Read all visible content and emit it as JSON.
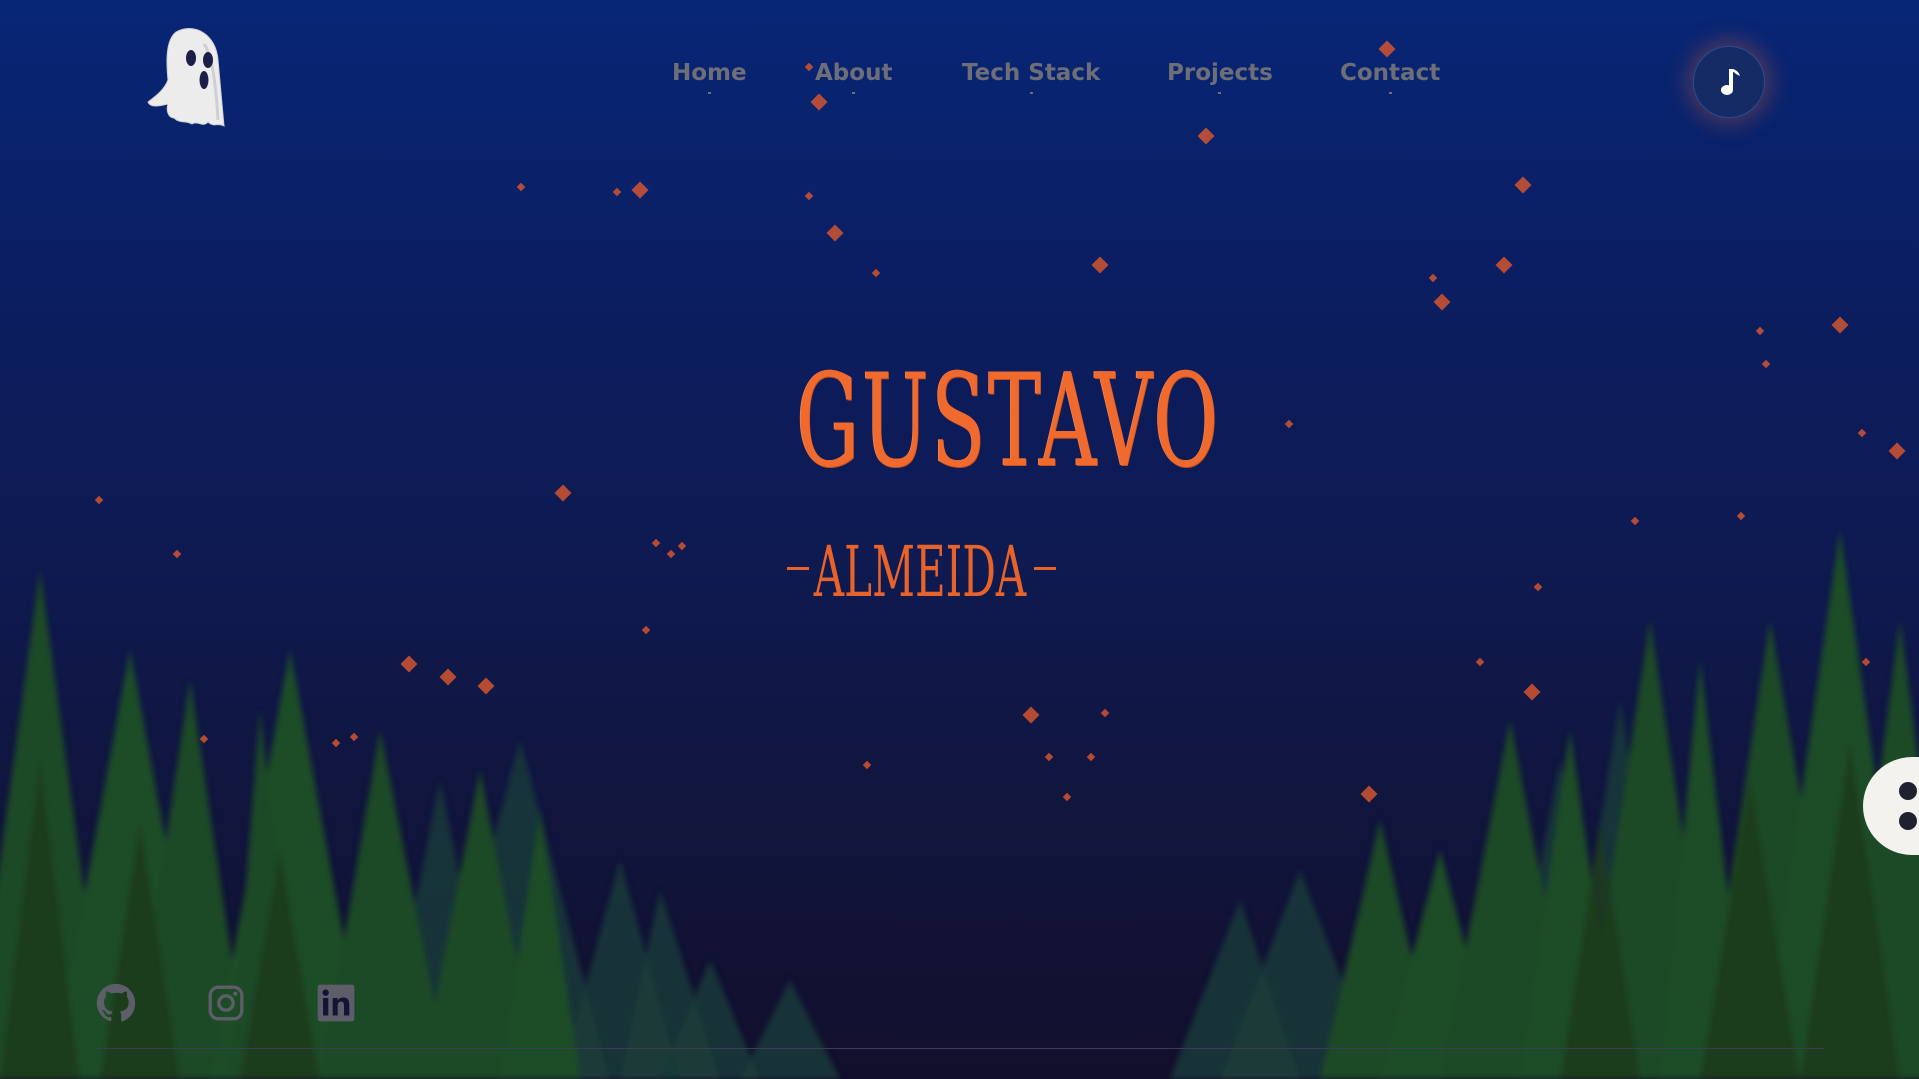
{
  "nav": {
    "home": "Home",
    "about": "About",
    "tech_stack": "Tech Stack",
    "projects": "Projects",
    "contact": "Contact"
  },
  "hero": {
    "first_name": "GUSTAVO",
    "last_name": "ALMEIDA"
  },
  "icons": {
    "logo": "ghost-icon",
    "music": "music-note-icon",
    "github": "github-icon",
    "instagram": "instagram-icon",
    "linkedin": "linkedin-icon",
    "side_menu": "drag-handle-icon"
  },
  "colors": {
    "accent": "#f06a2e",
    "nav_text": "#6e6e78",
    "forest": "#1c4a25",
    "sky_top": "#072676",
    "sky_bottom": "#120f2c"
  }
}
